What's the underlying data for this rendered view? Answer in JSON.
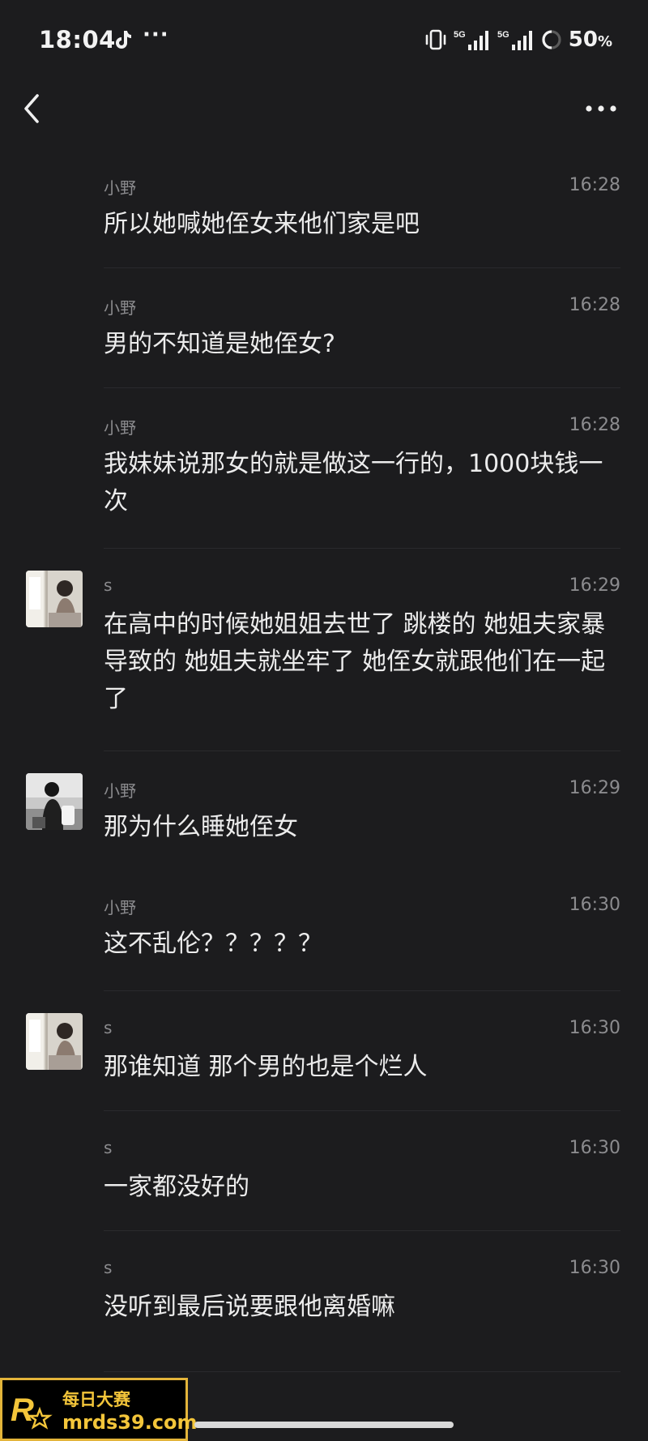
{
  "status_bar": {
    "time": "18:04",
    "more": "···",
    "battery_number": "50",
    "battery_symbol": "%",
    "signal_1": "5G",
    "signal_2": "5G"
  },
  "nav": {
    "back_icon": "chevron-left-icon",
    "more_icon": "ellipsis-icon"
  },
  "messages": [
    {
      "name": "小野",
      "time": "16:28",
      "text": "所以她喊她侄女来他们家是吧",
      "has_avatar": false
    },
    {
      "name": "小野",
      "time": "16:28",
      "text": "男的不知道是她侄女?",
      "has_avatar": false
    },
    {
      "name": "小野",
      "time": "16:28",
      "text": "我妹妹说那女的就是做这一行的，1000块钱一次",
      "has_avatar": false
    },
    {
      "name": "s",
      "time": "16:29",
      "text": "在高中的时候她姐姐去世了 跳楼的 她姐夫家暴导致的 她姐夫就坐牢了 她侄女就跟他们在一起了",
      "has_avatar": true
    },
    {
      "name": "小野",
      "time": "16:29",
      "text": "那为什么睡她侄女",
      "has_avatar": true
    },
    {
      "name": "小野",
      "time": "16:30",
      "text": "这不乱伦？？？？？",
      "has_avatar": false
    },
    {
      "name": "s",
      "time": "16:30",
      "text": "那谁知道 那个男的也是个烂人",
      "has_avatar": true
    },
    {
      "name": "s",
      "time": "16:30",
      "text": "一家都没好的",
      "has_avatar": false
    },
    {
      "name": "s",
      "time": "16:30",
      "text": "没听到最后说要跟他离婚嘛",
      "has_avatar": false
    }
  ],
  "watermark": {
    "line1": "每日大赛",
    "line2": "mrds39.com",
    "badge_letter": "R"
  },
  "colors": {
    "background": "#1c1c1e",
    "text": "#ececec",
    "muted": "#8b8b8e",
    "accent": "#f3c53a"
  }
}
